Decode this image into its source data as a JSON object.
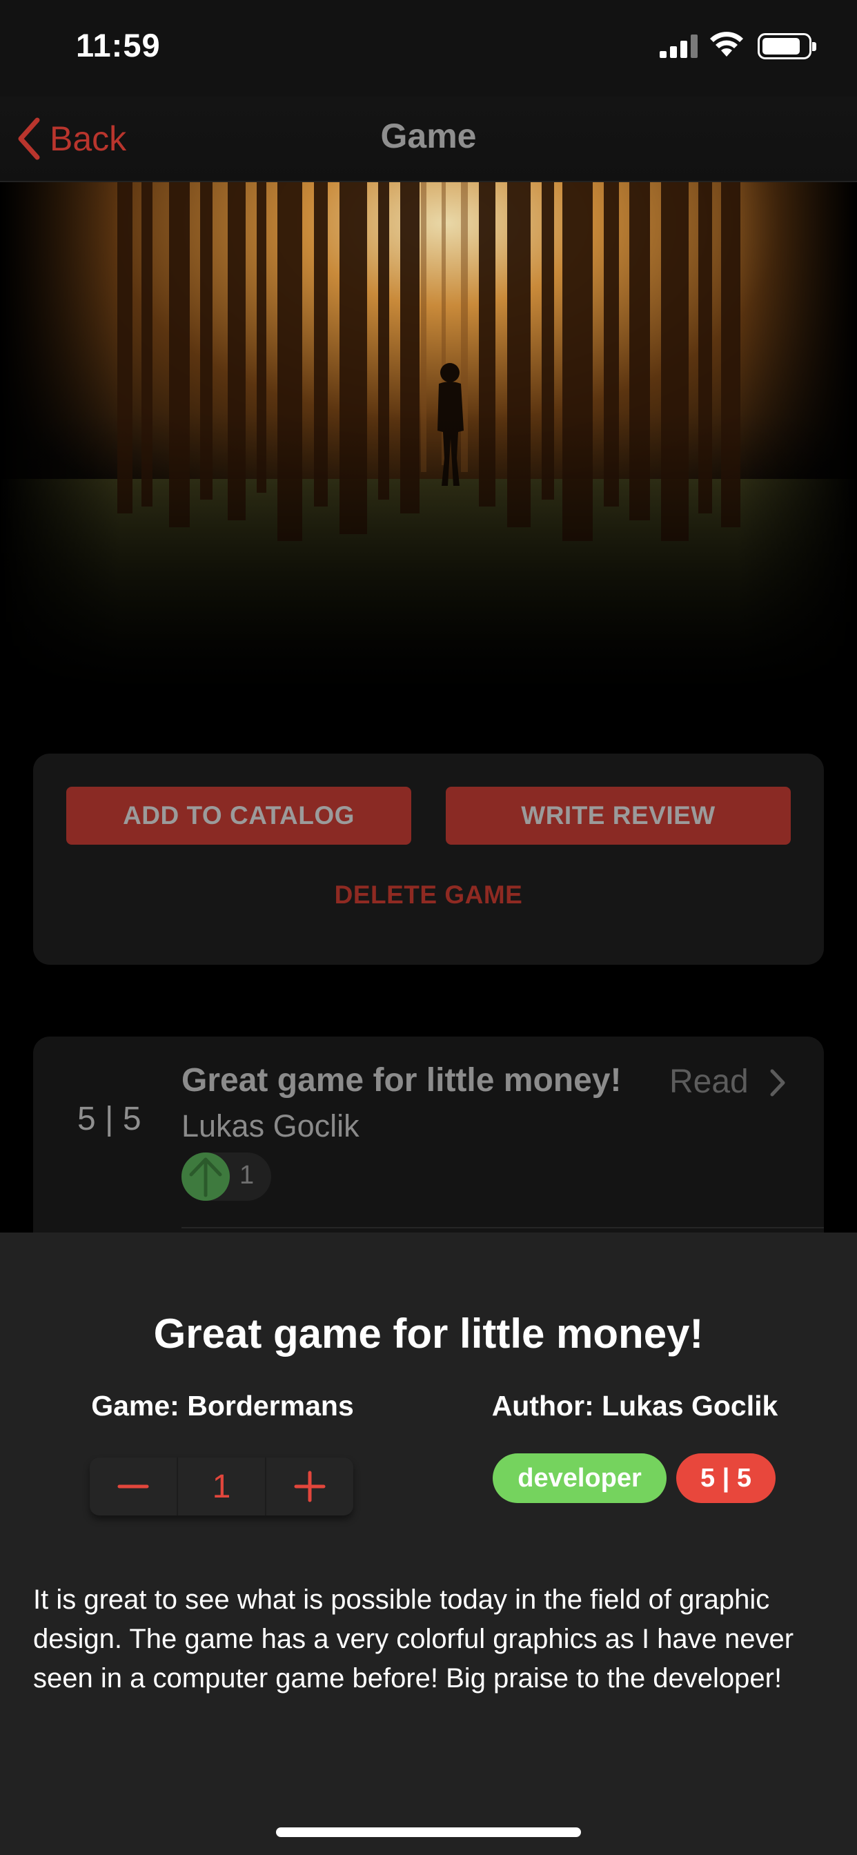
{
  "status_bar": {
    "time": "11:59"
  },
  "nav": {
    "back_label": "Back",
    "title": "Game"
  },
  "hero": {
    "image": "forest-silhouette-image"
  },
  "actions": {
    "add_to_catalog": "ADD TO CATALOG",
    "write_review": "WRITE REVIEW",
    "delete_game": "DELETE GAME"
  },
  "review_item": {
    "score": "5 | 5",
    "title": "Great game for little money!",
    "read_label": "Read",
    "author": "Lukas Goclik",
    "votes": "1"
  },
  "sheet": {
    "title": "Great game for little money!",
    "game": "Game: Bordermans",
    "author": "Author: Lukas Goclik",
    "stepper_value": "1",
    "role_badge": "developer",
    "score_badge": "5 | 5",
    "body": "It is great to see what is possible today in the field of graphic design. The game has a very colorful graphics as I have never seen in a computer game before! Big praise to the developer!"
  },
  "colors": {
    "accent": "#b9352d",
    "button_bg": "#8a2a24",
    "badge_green": "#75d35e",
    "badge_red": "#e8473c",
    "sheet_bg": "#222222"
  }
}
